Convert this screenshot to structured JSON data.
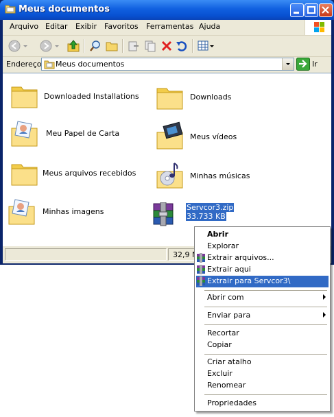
{
  "window": {
    "title": "Meus documentos"
  },
  "menubar": {
    "items": [
      "Arquivo",
      "Editar",
      "Exibir",
      "Favoritos",
      "Ferramentas",
      "Ajuda"
    ]
  },
  "address": {
    "label": "Endereço",
    "value": "Meus documentos",
    "go_label": "Ir"
  },
  "files": [
    {
      "name": "Downloaded Installations",
      "icon": "folder-icon"
    },
    {
      "name": "Downloads",
      "icon": "folder-icon"
    },
    {
      "name": "Meu Papel de Carta",
      "icon": "folder-stationery-icon"
    },
    {
      "name": "Meus vídeos",
      "icon": "folder-videos-icon"
    },
    {
      "name": "Meus arquivos recebidos",
      "icon": "folder-icon"
    },
    {
      "name": "Minhas músicas",
      "icon": "folder-music-icon"
    },
    {
      "name": "Minhas imagens",
      "icon": "folder-pictures-icon"
    },
    {
      "name": "Servcor3.zip",
      "size": "33.733 KB",
      "icon": "winrar-archive-icon",
      "selected": true
    }
  ],
  "status": {
    "text": "32,9 M"
  },
  "context_menu": {
    "items": [
      {
        "label": "Abrir",
        "bold": true
      },
      {
        "label": "Explorar"
      },
      {
        "label": "Extrair arquivos...",
        "icon": "winrar-icon"
      },
      {
        "label": "Extrair aqui",
        "icon": "winrar-icon"
      },
      {
        "label": "Extrair para Servcor3\\",
        "icon": "winrar-icon",
        "highlighted": true
      },
      {
        "label": "Abrir com",
        "submenu": true
      },
      {
        "label": "Enviar para",
        "submenu": true
      },
      {
        "label": "Recortar"
      },
      {
        "label": "Copiar"
      },
      {
        "label": "Criar atalho"
      },
      {
        "label": "Excluir"
      },
      {
        "label": "Renomear"
      },
      {
        "label": "Propriedades"
      }
    ]
  },
  "colors": {
    "selection": "#316ac5",
    "titlebar": "#0a58e0",
    "chrome": "#ece9d8"
  }
}
